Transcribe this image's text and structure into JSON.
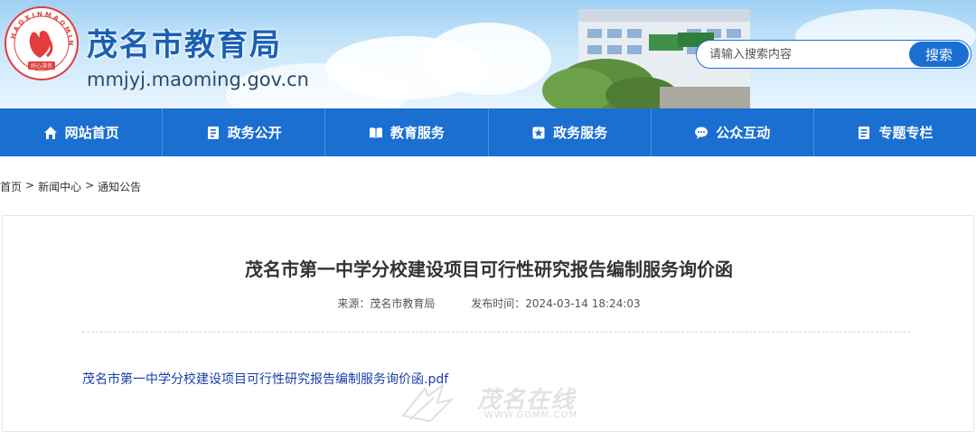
{
  "header": {
    "site_name": "茂名市教育局",
    "site_url": "mmjyj.maoming.gov.cn",
    "logo_ring_text": "HAOXINMAOMING",
    "logo_bottom_text": "好心茂名",
    "brand_color": "#1a6fd1"
  },
  "search": {
    "placeholder": "请输入搜索内容",
    "button_label": "搜索"
  },
  "nav": {
    "items": [
      {
        "label": "网站首页",
        "icon": "home-icon"
      },
      {
        "label": "政务公开",
        "icon": "document-icon"
      },
      {
        "label": "教育服务",
        "icon": "book-icon"
      },
      {
        "label": "政务服务",
        "icon": "star-badge-icon"
      },
      {
        "label": "公众互动",
        "icon": "chat-icon"
      },
      {
        "label": "专题专栏",
        "icon": "list-icon"
      }
    ]
  },
  "breadcrumb": {
    "items": [
      "首页",
      "新闻中心",
      "通知公告"
    ],
    "separator": ">"
  },
  "article": {
    "title": "茂名市第一中学分校建设项目可行性研究报告编制服务询价函",
    "source": "来源：茂名市教育局",
    "publish_time": "发布时间：2024-03-14 18:24:03",
    "attachment": "茂名市第一中学分校建设项目可行性研究报告编制服务询价函.pdf"
  },
  "watermark": {
    "text": "茂名在线",
    "url": "WWW.GDMM.COM"
  }
}
